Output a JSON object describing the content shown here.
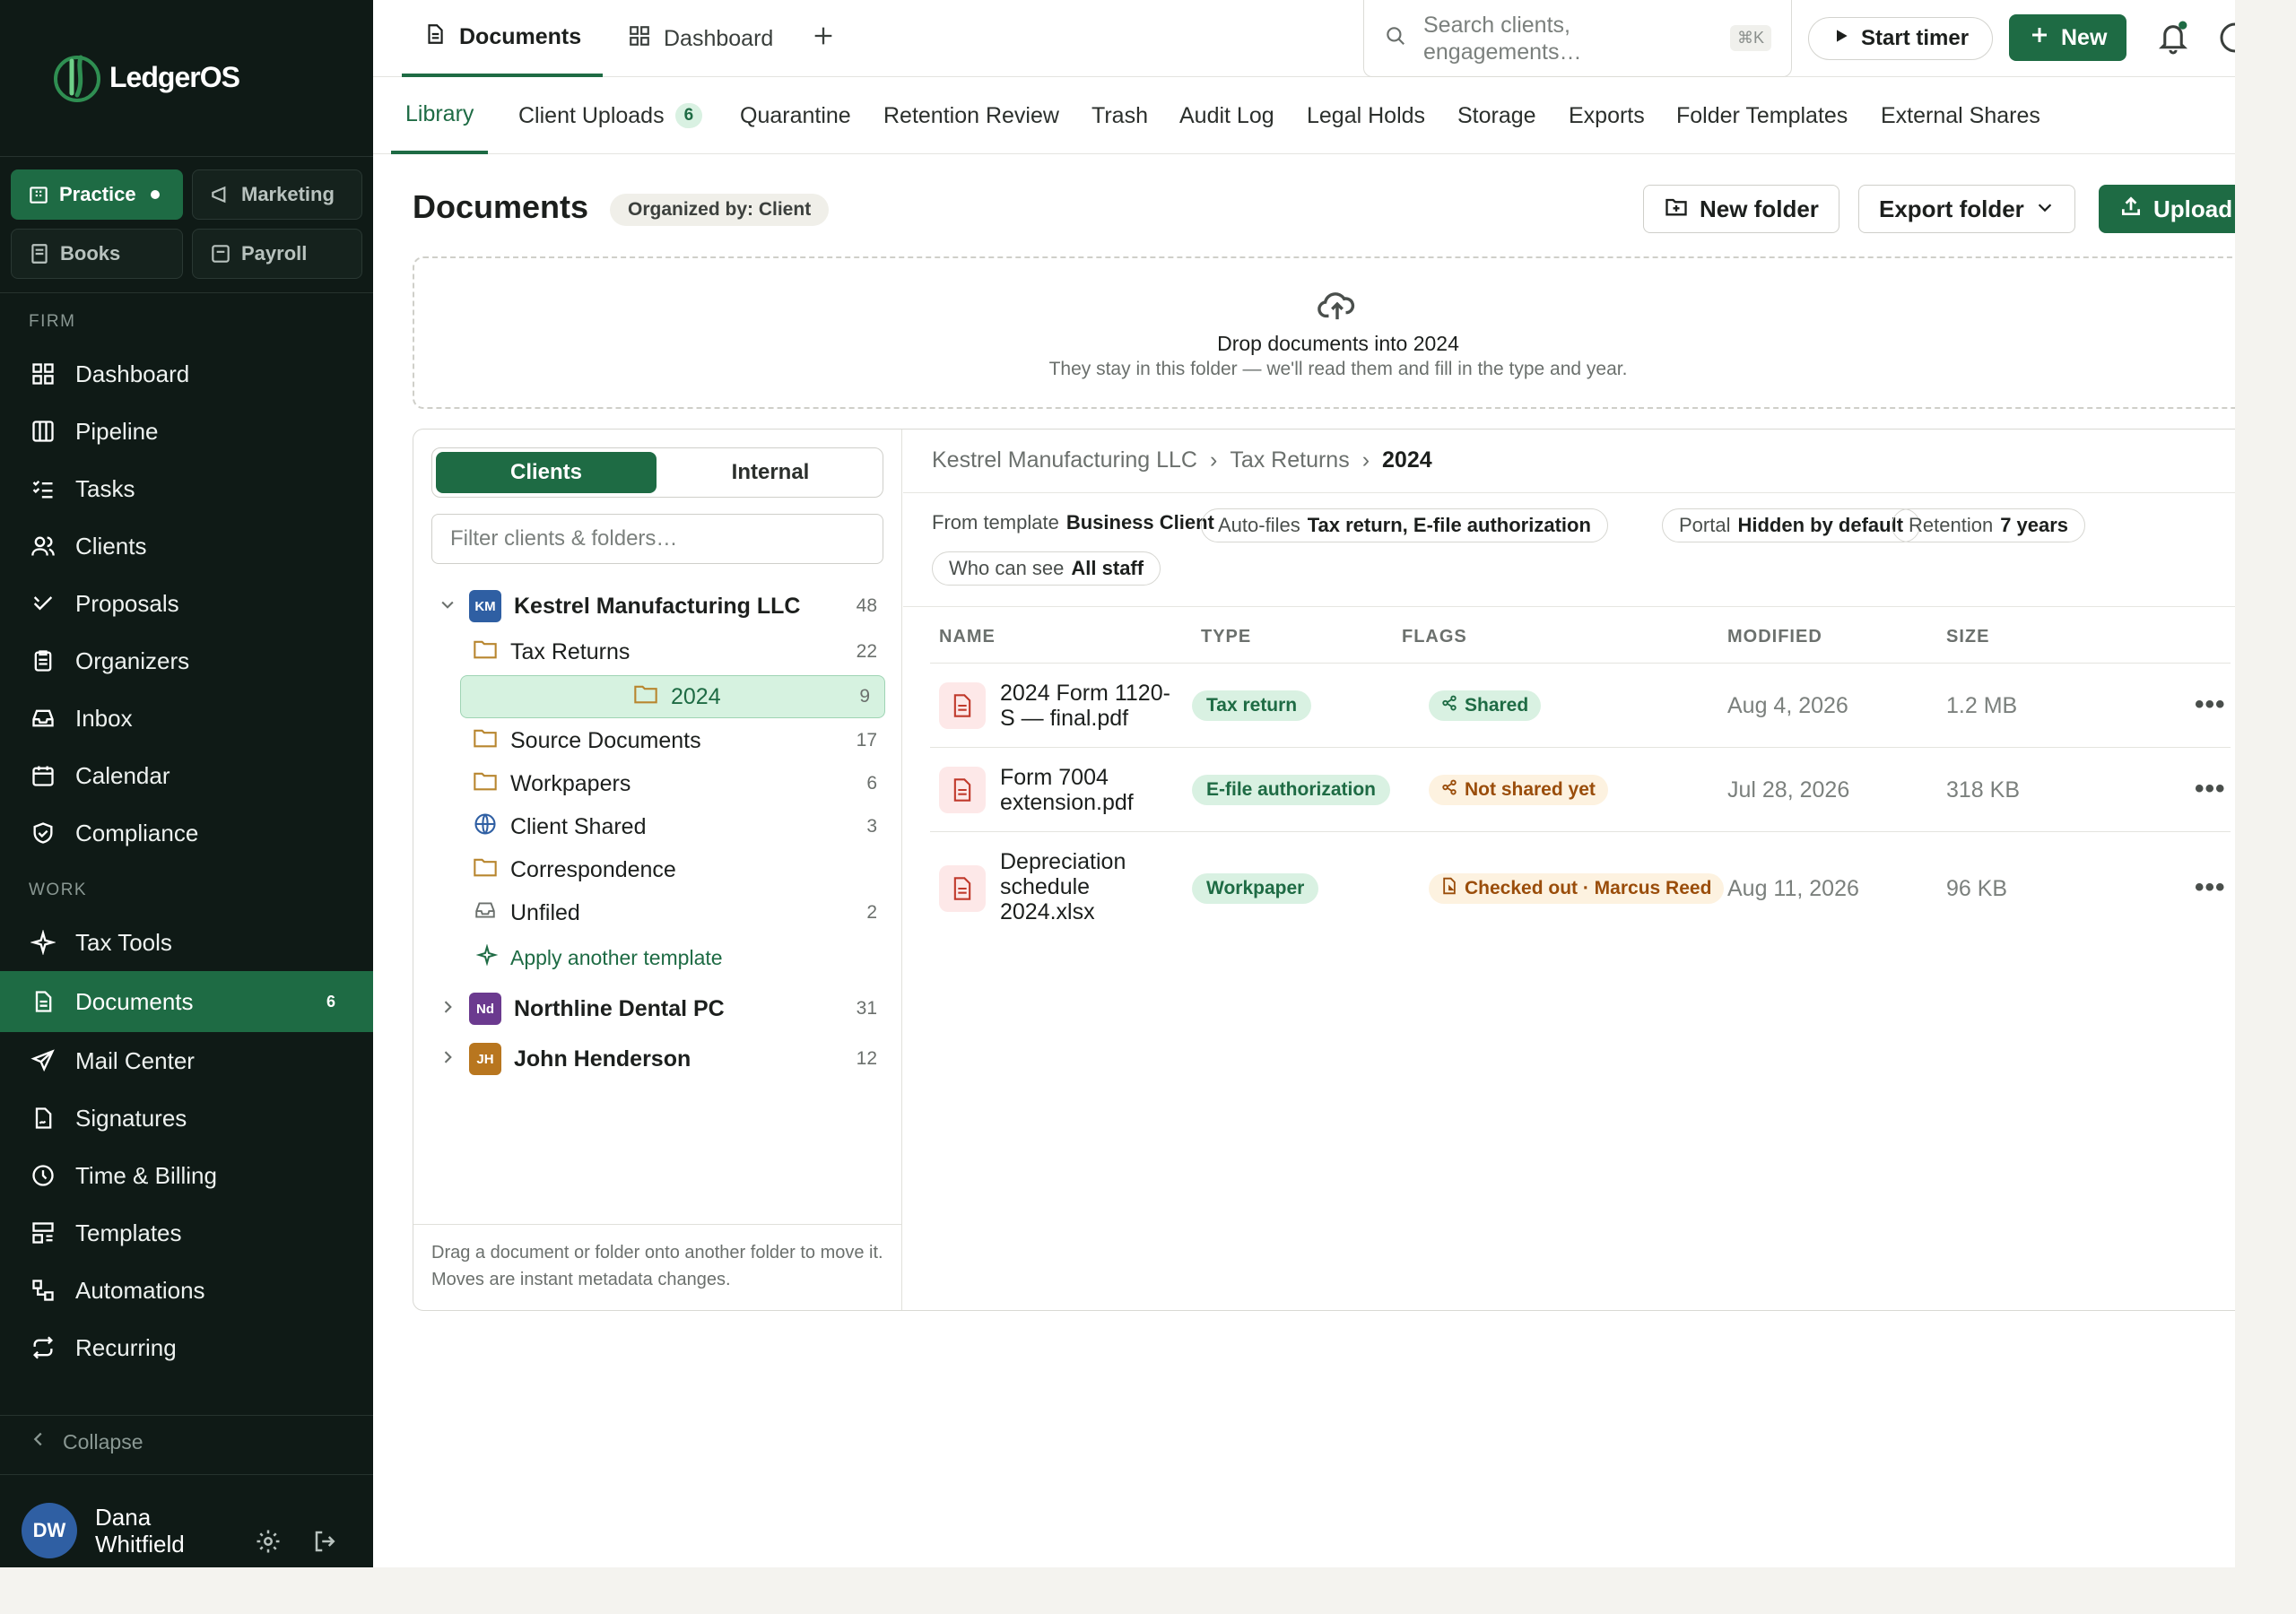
{
  "brand": {
    "name": "LedgerOS"
  },
  "workspaces": [
    {
      "label": "Practice",
      "active": true
    },
    {
      "label": "Marketing"
    },
    {
      "label": "Books"
    },
    {
      "label": "Payroll"
    }
  ],
  "sidebar": {
    "sections": [
      {
        "label": "FIRM",
        "items": [
          {
            "label": "Dashboard",
            "icon": "dashboard-icon"
          },
          {
            "label": "Pipeline",
            "icon": "pipeline-icon"
          },
          {
            "label": "Tasks",
            "icon": "tasks-icon"
          },
          {
            "label": "Clients",
            "icon": "clients-icon"
          },
          {
            "label": "Proposals",
            "icon": "proposals-icon"
          },
          {
            "label": "Organizers",
            "icon": "organizers-icon"
          },
          {
            "label": "Inbox",
            "icon": "inbox-icon"
          },
          {
            "label": "Calendar",
            "icon": "calendar-icon"
          },
          {
            "label": "Compliance",
            "icon": "shield-icon"
          }
        ]
      },
      {
        "label": "WORK",
        "items": [
          {
            "label": "Tax Tools",
            "icon": "sparkle-icon"
          },
          {
            "label": "Documents",
            "icon": "document-icon",
            "badge": "6",
            "active": true
          },
          {
            "label": "Mail Center",
            "icon": "send-icon"
          },
          {
            "label": "Signatures",
            "icon": "signature-icon"
          },
          {
            "label": "Time & Billing",
            "icon": "clock-icon"
          },
          {
            "label": "Templates",
            "icon": "templates-icon"
          },
          {
            "label": "Automations",
            "icon": "automations-icon"
          },
          {
            "label": "Recurring",
            "icon": "recurring-icon"
          }
        ]
      }
    ],
    "collapse_label": "Collapse",
    "user": {
      "initials": "DW",
      "name": "Dana Whitfield"
    }
  },
  "topbar": {
    "tabs": [
      {
        "label": "Documents",
        "active": true
      },
      {
        "label": "Dashboard"
      }
    ],
    "search_placeholder": "Search clients, engagements…",
    "search_shortcut": "⌘K",
    "start_timer": "Start timer",
    "new_label": "New"
  },
  "subtabs": [
    {
      "label": "Library",
      "active": true
    },
    {
      "label": "Client Uploads",
      "count": "6"
    },
    {
      "label": "Quarantine"
    },
    {
      "label": "Retention Review"
    },
    {
      "label": "Trash"
    },
    {
      "label": "Audit Log"
    },
    {
      "label": "Legal Holds"
    },
    {
      "label": "Storage"
    },
    {
      "label": "Exports"
    },
    {
      "label": "Folder Templates"
    },
    {
      "label": "External Shares"
    }
  ],
  "page": {
    "title": "Documents",
    "organized_by": "Organized by: Client",
    "new_folder": "New folder",
    "export_folder": "Export folder",
    "upload": "Upload"
  },
  "dropzone": {
    "title": "Drop documents into 2024",
    "subtitle": "They stay in this folder — we'll read them and fill in the type and year."
  },
  "tree": {
    "toggle": [
      "Clients",
      "Internal"
    ],
    "filter_placeholder": "Filter clients & folders…",
    "clients": [
      {
        "initials": "KM",
        "name": "Kestrel Manufacturing LLC",
        "count": "48",
        "color": "#2f5fa3",
        "expanded": true
      },
      {
        "initials": "Nd",
        "name": "Northline Dental PC",
        "count": "31",
        "color": "#6b3a8f"
      },
      {
        "initials": "JH",
        "name": "John Henderson",
        "count": "12",
        "color": "#b8761f"
      }
    ],
    "folders": [
      {
        "name": "Tax Returns",
        "count": "22",
        "icon": "folder-icon"
      },
      {
        "name": "2024",
        "count": "9",
        "icon": "folder-icon",
        "selected": true
      },
      {
        "name": "Source Documents",
        "count": "17",
        "icon": "folder-icon"
      },
      {
        "name": "Workpapers",
        "count": "6",
        "icon": "folder-icon"
      },
      {
        "name": "Client Shared",
        "count": "3",
        "icon": "globe-icon"
      },
      {
        "name": "Correspondence",
        "count": "",
        "icon": "folder-icon"
      },
      {
        "name": "Unfiled",
        "count": "2",
        "icon": "inbox-icon"
      }
    ],
    "apply_template": "Apply another template",
    "footer": "Drag a document or folder onto another folder to move it. Moves are instant metadata changes."
  },
  "content": {
    "breadcrumb": [
      "Kestrel Manufacturing LLC",
      "Tax Returns",
      "2024"
    ],
    "meta": {
      "from_template_label": "From template",
      "from_template_value": "Business Client",
      "autofiles_label": "Auto-files",
      "autofiles_value": "Tax return, E-file authorization",
      "portal_label": "Portal",
      "portal_value": "Hidden by default",
      "retention_label": "Retention",
      "retention_value": "7 years",
      "who_label": "Who can see",
      "who_value": "All staff"
    },
    "columns": [
      "NAME",
      "TYPE",
      "FLAGS",
      "MODIFIED",
      "SIZE"
    ],
    "rows": [
      {
        "name": "2024 Form 1120-S — final.pdf",
        "type": "Tax return",
        "flag": "Shared",
        "flag_kind": "shared",
        "modified": "Aug 4, 2026",
        "size": "1.2 MB"
      },
      {
        "name": "Form 7004 extension.pdf",
        "type": "E-file authorization",
        "flag": "Not shared yet",
        "flag_kind": "warn",
        "modified": "Jul 28, 2026",
        "size": "318 KB"
      },
      {
        "name": "Depreciation schedule 2024.xlsx",
        "type": "Workpaper",
        "flag": "Checked out · Marcus Reed",
        "flag_kind": "warn",
        "modified": "Aug 11, 2026",
        "size": "96 KB"
      }
    ],
    "more_label": "•••"
  },
  "colors": {
    "accent": "#1e6b44",
    "sidebar_bg": "#0f1a16",
    "warn": "#9a4d0a"
  }
}
